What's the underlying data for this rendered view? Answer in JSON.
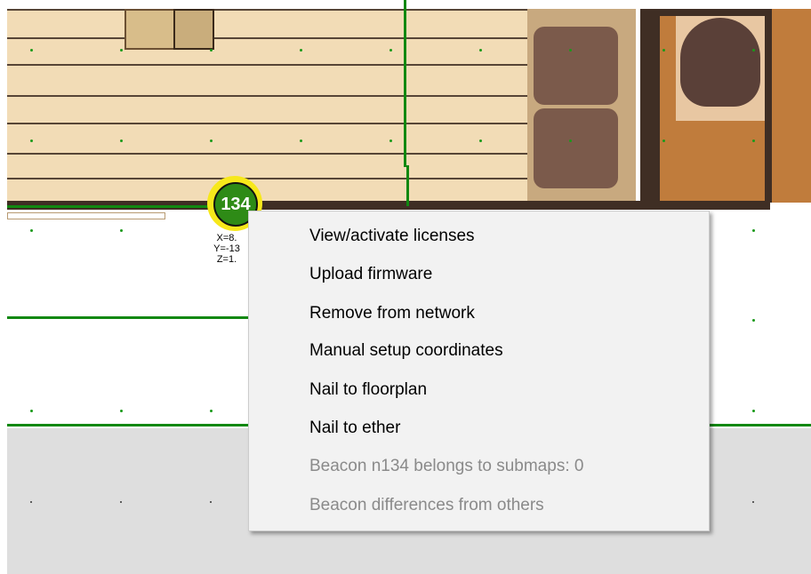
{
  "beacon": {
    "id_label": "134",
    "coord_x": "X=8.",
    "coord_y": "Y=-13",
    "coord_z": "Z=1."
  },
  "context_menu": {
    "items": [
      {
        "label": "View/activate licenses",
        "enabled": true
      },
      {
        "label": "Upload firmware",
        "enabled": true
      },
      {
        "label": "Remove from network",
        "enabled": true
      },
      {
        "label": "Manual setup coordinates",
        "enabled": true
      },
      {
        "label": "Nail to floorplan",
        "enabled": true
      },
      {
        "label": "Nail to ether",
        "enabled": true
      },
      {
        "label": "Beacon n134 belongs to submaps: 0",
        "enabled": false
      },
      {
        "label": "Beacon differences from others",
        "enabled": false
      }
    ]
  },
  "colors": {
    "wood": "#f2dcb6",
    "wall": "#3f2e24",
    "grid_line": "#118811",
    "beacon_ring": "#f7e81b",
    "beacon_fill": "#2e8b16",
    "menu_bg": "#f2f2f2",
    "disabled_text": "#8a8a8a"
  }
}
